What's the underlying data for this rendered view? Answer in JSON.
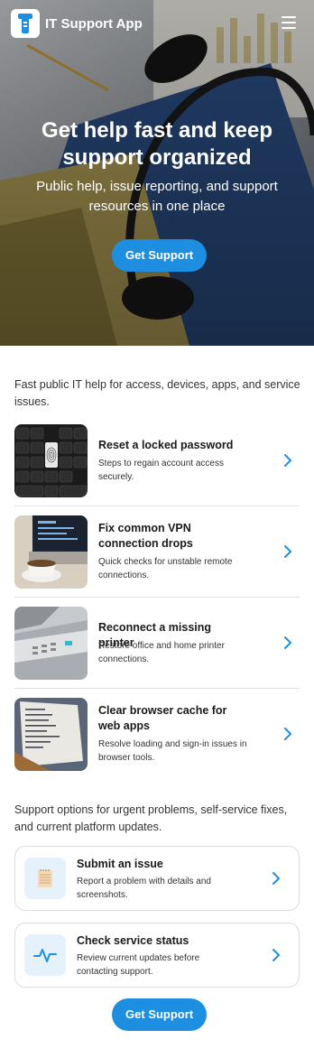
{
  "header": {
    "app_title": "IT Support App",
    "logo_icon": "wrench-logo-icon",
    "menu_icon": "hamburger-menu-icon"
  },
  "hero": {
    "title": "Get help fast and keep support organized",
    "subtitle": "Public help, issue reporting, and support resources in one place",
    "cta_label": "Get Support"
  },
  "guides": {
    "intro": "Fast public IT help for access, devices, apps, and service issues.",
    "items": [
      {
        "title": "Reset a locked password",
        "description": "Steps to regain account access securely."
      },
      {
        "title": "Fix common VPN connection drops",
        "description": "Quick checks for unstable remote connections."
      },
      {
        "title": "Reconnect a missing printer",
        "description": "Restore office and home printer connections."
      },
      {
        "title": "Clear browser cache for web apps",
        "description": "Resolve loading and sign-in issues in browser tools."
      }
    ]
  },
  "support": {
    "intro": "Support options for urgent problems, self-service fixes, and current platform updates.",
    "cards": [
      {
        "title": "Submit an issue",
        "description": "Report a problem with details and screenshots.",
        "icon": "notepad-icon"
      },
      {
        "title": "Check service status",
        "description": "Review current updates before contacting support.",
        "icon": "pulse-icon"
      }
    ],
    "cta_label": "Get Support"
  },
  "colors": {
    "accent": "#1e8fe0",
    "icon_bg": "#e6f2fb"
  }
}
